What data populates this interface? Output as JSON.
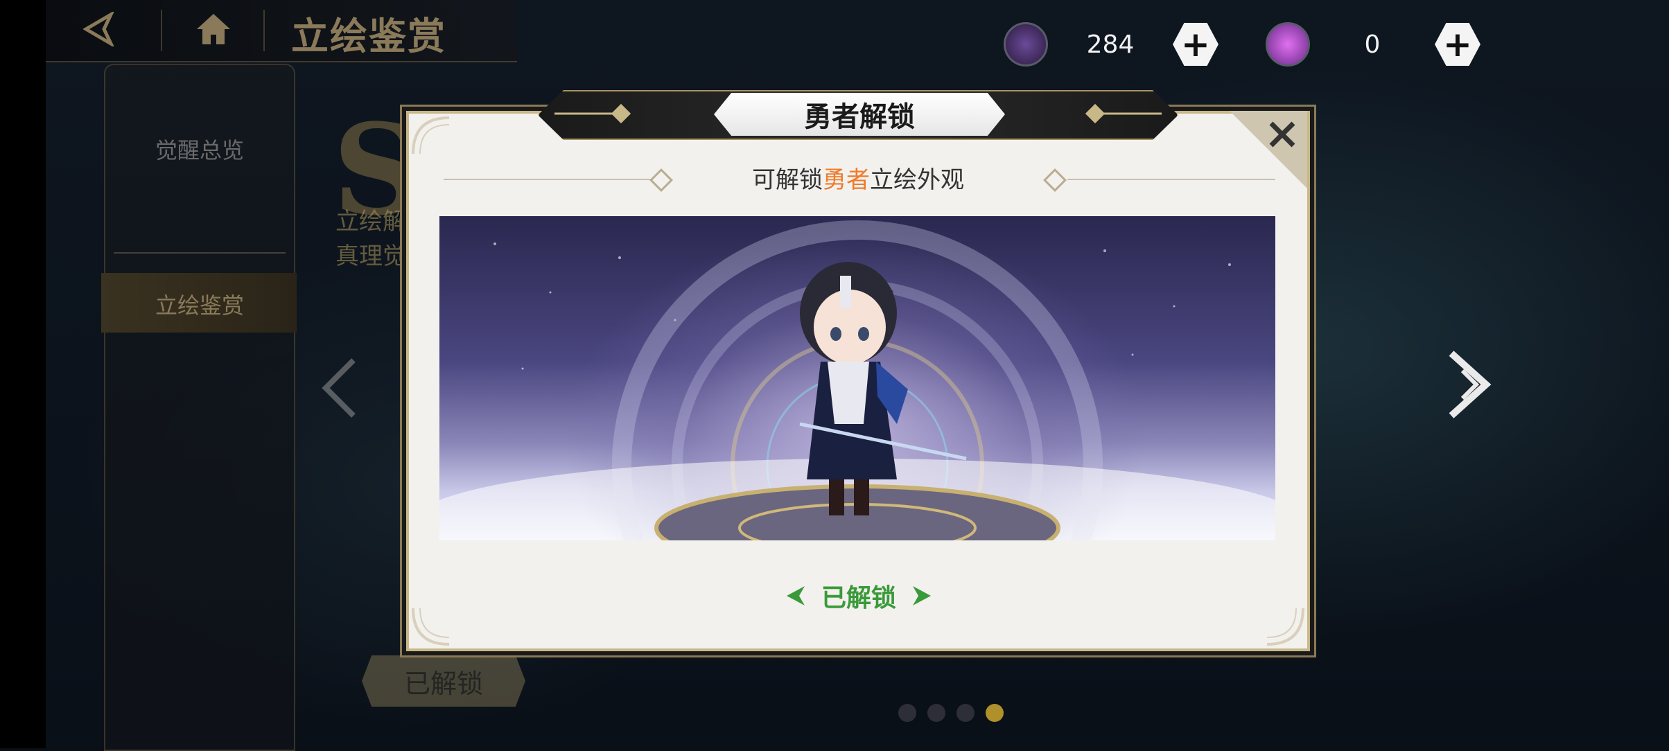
{
  "header": {
    "title": "立绘鉴赏"
  },
  "currencies": [
    {
      "icon": "purple-crystal-icon",
      "value": "284"
    },
    {
      "icon": "purple-orb-icon",
      "value": "0"
    }
  ],
  "sidebar": {
    "items": [
      {
        "label": "觉醒总览"
      },
      {
        "label": "立绘鉴赏"
      }
    ]
  },
  "background": {
    "subtitle_1": "立绘解",
    "subtitle_2": "真理觉",
    "unlock_button": "已解锁"
  },
  "modal": {
    "title": "勇者解锁",
    "subtitle_prefix": "可解锁",
    "subtitle_highlight": "勇者",
    "subtitle_suffix": "立绘外观",
    "status": "已解锁",
    "highlight_color": "#f07a2a",
    "status_color": "#3a9a3a"
  },
  "pagination": {
    "total": 4,
    "current": 4
  }
}
